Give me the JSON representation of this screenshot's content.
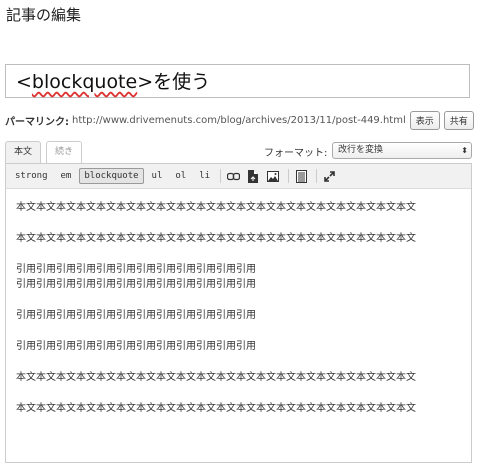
{
  "page": {
    "heading": "記事の編集"
  },
  "post": {
    "title_prefix": "<",
    "title_spell": "blockquote",
    "title_suffix": ">を使う"
  },
  "permalink": {
    "label": "パーマリンク:",
    "url": "http://www.drivemenuts.com/blog/archives/2013/11/post-449.html",
    "view_button": "表示",
    "share_button": "共有"
  },
  "tabs": {
    "visual": "本文",
    "continued": "続き"
  },
  "format": {
    "label": "フォーマット:",
    "selected": "改行を変換"
  },
  "toolbar": {
    "buttons": [
      "strong",
      "em",
      "blockquote",
      "ul",
      "ol",
      "li"
    ],
    "active": "blockquote",
    "icons": [
      "link-icon",
      "file-icon",
      "image-icon",
      "table-icon",
      "fullscreen-icon"
    ]
  },
  "body": {
    "lines": [
      "本文本文本文本文本文本文本文本文本文本文本文本文本文本文本文本文本文本文本文本文",
      "本文本文本文本文本文本文本文本文本文本文本文本文本文本文本文本文本文本文本文本文",
      "引用引用引用引用引用引用引用引用引用引用引用引用",
      "引用引用引用引用引用引用引用引用引用引用引用引用",
      "引用引用引用引用引用引用引用引用引用引用引用引用",
      "引用引用引用引用引用引用引用引用引用引用引用引用",
      "本文本文本文本文本文本文本文本文本文本文本文本文本文本文本文本文本文本文本文本文",
      "本文本文本文本文本文本文本文本文本文本文本文本文本文本文本文本文本文本文本文本文"
    ]
  }
}
